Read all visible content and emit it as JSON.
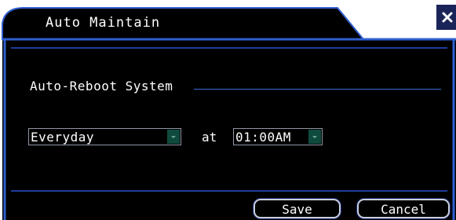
{
  "dialog": {
    "title": "Auto Maintain",
    "close_icon": "close-icon"
  },
  "auto_reboot": {
    "section_label": "Auto-Reboot System",
    "frequency_value": "Everyday",
    "at_label": "at",
    "time_value": "01:00AM"
  },
  "footer": {
    "save_label": "Save",
    "cancel_label": "Cancel"
  },
  "colors": {
    "panel_background": "#000000",
    "frame_blue": "#2f5fd0",
    "button_border": "#c9ced8",
    "dropdown_arrow": "#0f4a3e"
  }
}
